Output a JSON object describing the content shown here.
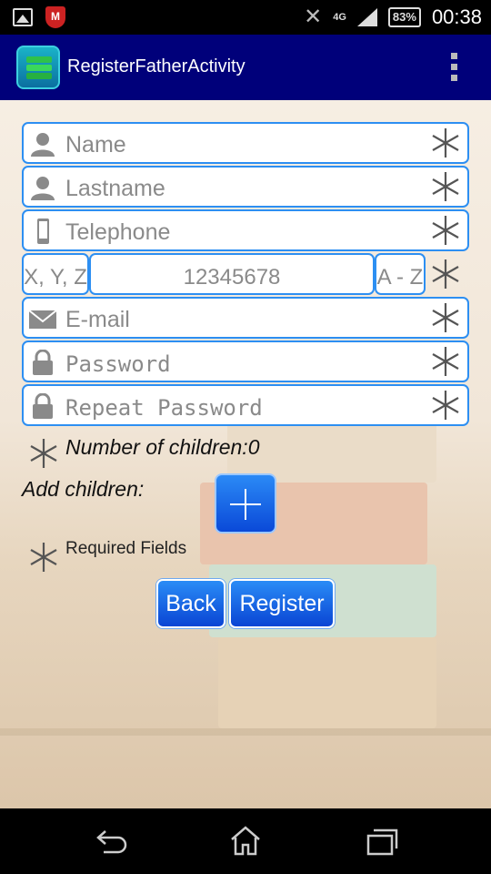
{
  "status_bar": {
    "network": "4G",
    "battery": "83%",
    "time": "00:38"
  },
  "action_bar": {
    "title": "RegisterFatherActivity",
    "menu_icon": "overflow-menu-icon"
  },
  "form": {
    "name": {
      "placeholder": "Name",
      "icon": "person-icon"
    },
    "lastname": {
      "placeholder": "Lastname",
      "icon": "person-icon"
    },
    "telephone": {
      "placeholder": "Telephone",
      "icon": "phone-icon"
    },
    "id_prefix": {
      "placeholder": "X, Y, Z"
    },
    "id_number": {
      "value": "12345678"
    },
    "id_suffix": {
      "placeholder": "A - Z"
    },
    "email": {
      "placeholder": "E-mail",
      "icon": "mail-icon"
    },
    "password": {
      "placeholder": "Password",
      "icon": "lock-icon"
    },
    "repeat_password": {
      "placeholder": "Repeat Password",
      "icon": "lock-icon"
    }
  },
  "children": {
    "count_label": "Number of children:0",
    "add_label": "Add children:"
  },
  "legend": {
    "required_label": "Required Fields"
  },
  "buttons": {
    "back": "Back",
    "register": "Register"
  },
  "colors": {
    "action_bar": "#00007a",
    "field_border": "#2d8ff2",
    "button": "#0a45d4"
  }
}
